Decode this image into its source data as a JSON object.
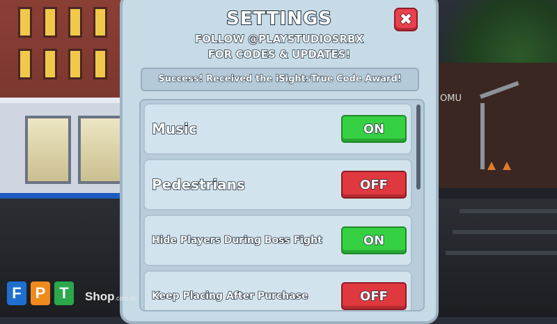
{
  "settings": {
    "title": "SETTINGS",
    "subtitle_line1": "FOLLOW @PLAYSTUDIOSRBX",
    "subtitle_line2": "FOR CODES & UPDATES!",
    "close_label": "✖",
    "message": "Success! Received the iSightsTrue Code Award!",
    "options": [
      {
        "label": "Music",
        "state": "ON"
      },
      {
        "label": "Pedestrians",
        "state": "OFF"
      },
      {
        "label": "Hide Players During Boss Fight",
        "state": "ON"
      },
      {
        "label": "Keep Placing After Purchase",
        "state": "OFF"
      }
    ]
  },
  "scene": {
    "sign_text": "OMU"
  },
  "watermark": {
    "letters": [
      "F",
      "P",
      "T"
    ],
    "shop": "Shop",
    "domain": ".com.vn"
  },
  "colors": {
    "on": "#36d043",
    "off": "#e0383f",
    "panel": "#c7dbe7",
    "close": "#e8414d"
  }
}
